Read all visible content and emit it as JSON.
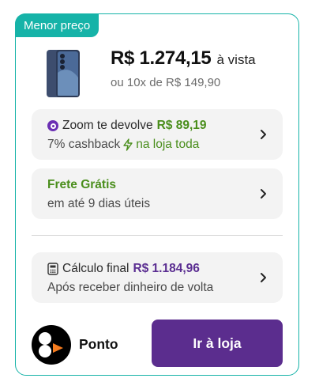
{
  "badge": {
    "label": "Menor preço"
  },
  "offer": {
    "price": "R$ 1.274,15",
    "price_suffix": "à vista",
    "installments": "ou 10x de R$ 149,90"
  },
  "cashback": {
    "line1_prefix": "Zoom te devolve",
    "amount": "R$ 89,19",
    "line2_prefix": "7% cashback",
    "line2_suffix": "na loja toda"
  },
  "shipping": {
    "title": "Frete Grátis",
    "subtitle": "em até 9 dias úteis"
  },
  "final_calc": {
    "label": "Cálculo final",
    "amount": "R$ 1.184,96",
    "subtitle": "Após receber dinheiro de volta"
  },
  "store": {
    "name": "Ponto",
    "cta_label": "Ir à loja"
  },
  "colors": {
    "accent_teal": "#16b3a8",
    "brand_purple": "#5b2d8e",
    "cashback_green": "#4a8e1c"
  },
  "icons": {
    "product": "phone-image",
    "cashback": "zoom-coin-icon",
    "lightning": "lightning-icon",
    "calculator": "calculator-icon",
    "chevron": "chevron-right-icon"
  }
}
